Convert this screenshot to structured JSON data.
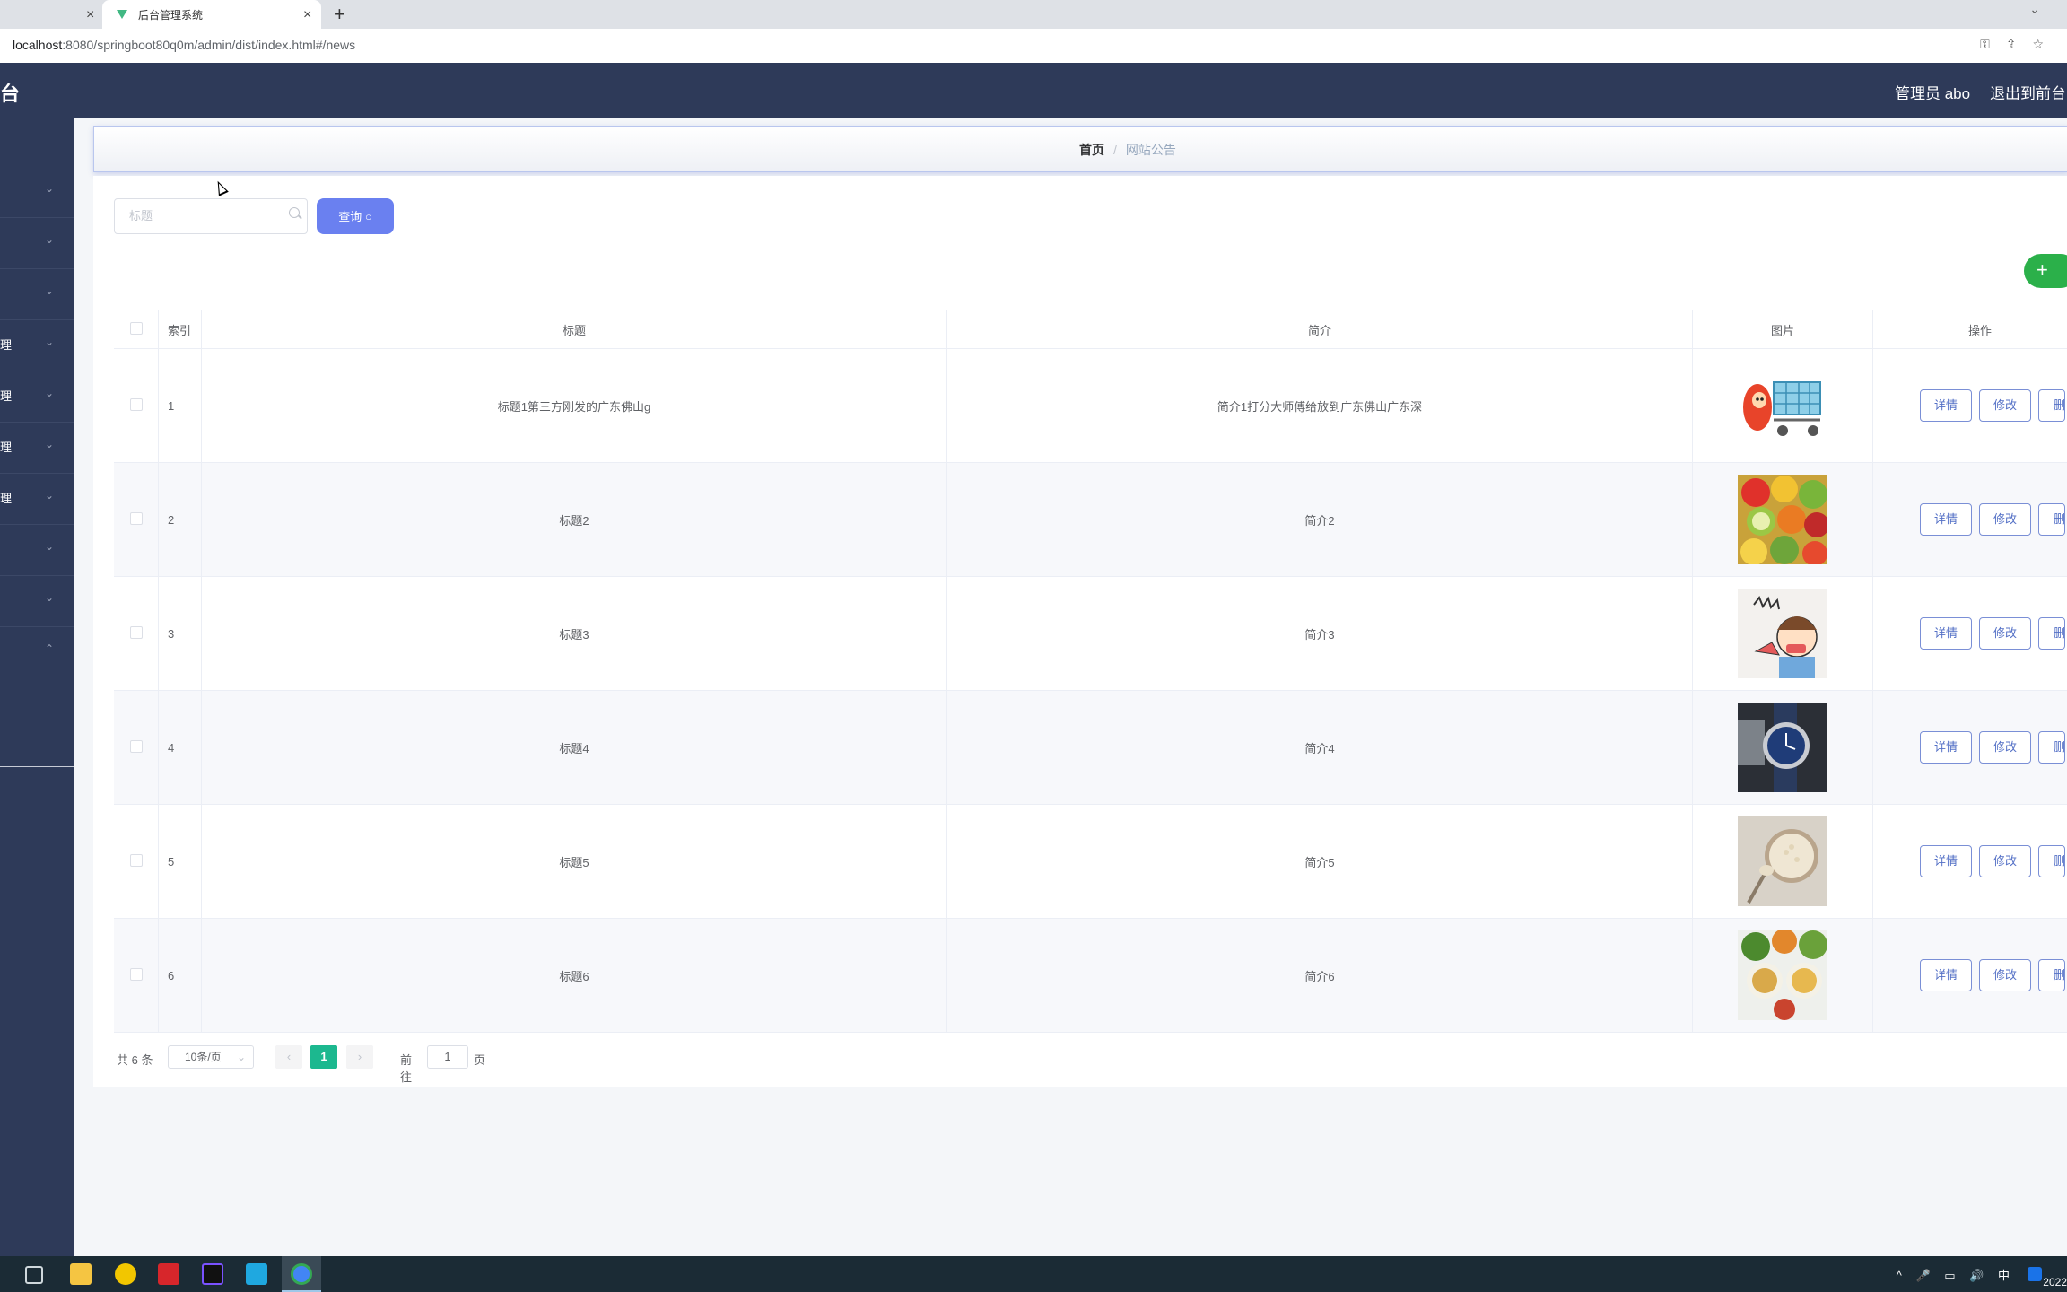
{
  "browser": {
    "tabs": [
      {
        "label": "",
        "active": false
      },
      {
        "label": "后台管理系统",
        "active": true
      }
    ],
    "new_tab": "+",
    "close_glyph": "×",
    "url_host": "localhost",
    "url_path": ":8080/springboot80q0m/admin/dist/index.html#/news"
  },
  "header": {
    "brand": "台",
    "admin": "管理员 abo",
    "exit": "退出到前台"
  },
  "sidebar": {
    "items": [
      {
        "label": "",
        "chevron": "⌄"
      },
      {
        "label": "",
        "chevron": "⌄"
      },
      {
        "label": "",
        "chevron": "⌄"
      },
      {
        "label": "理",
        "chevron": "⌄"
      },
      {
        "label": "理",
        "chevron": "⌄"
      },
      {
        "label": "理",
        "chevron": "⌄"
      },
      {
        "label": "理",
        "chevron": "⌄"
      },
      {
        "label": "",
        "chevron": "⌄"
      },
      {
        "label": "",
        "chevron": "⌄"
      }
    ],
    "expanded_chevron": "⌃"
  },
  "breadcrumb": {
    "home": "首页",
    "separator": "/",
    "current": "网站公告"
  },
  "search": {
    "placeholder": "标题",
    "query_button": "查询 ○",
    "add_button": "+"
  },
  "table": {
    "columns": [
      "",
      "索引",
      "标题",
      "简介",
      "图片",
      "操作"
    ],
    "rows": [
      {
        "index": "1",
        "title": "标题1第三方刚发的广东佛山g",
        "intro": "简介1打分大师傅给放到广东佛山广东深",
        "image": "cart-mascot"
      },
      {
        "index": "2",
        "title": "标题2",
        "intro": "简介2",
        "image": "fruit"
      },
      {
        "index": "3",
        "title": "标题3",
        "intro": "简介3",
        "image": "cartoon-kid"
      },
      {
        "index": "4",
        "title": "标题4",
        "intro": "简介4",
        "image": "watch"
      },
      {
        "index": "5",
        "title": "标题5",
        "intro": "简介5",
        "image": "oats"
      },
      {
        "index": "6",
        "title": "标题6",
        "intro": "简介6",
        "image": "salad"
      }
    ],
    "actions": {
      "detail": "详情",
      "edit": "修改",
      "delete": "删"
    }
  },
  "pagination": {
    "total": "共 6 条",
    "page_size": "10条/页",
    "prev": "‹",
    "next": "›",
    "current_page": "1",
    "goto_label": "前往",
    "goto_value": "1",
    "page_word": "页"
  },
  "taskbar": {
    "tray": "^ 🎤 ▭ 🔊 中",
    "clock": "2022"
  },
  "colors": {
    "header": "#2e3a59",
    "primary": "#6a80f0",
    "success": "#2bb04a",
    "page_active": "#1cb88f"
  }
}
